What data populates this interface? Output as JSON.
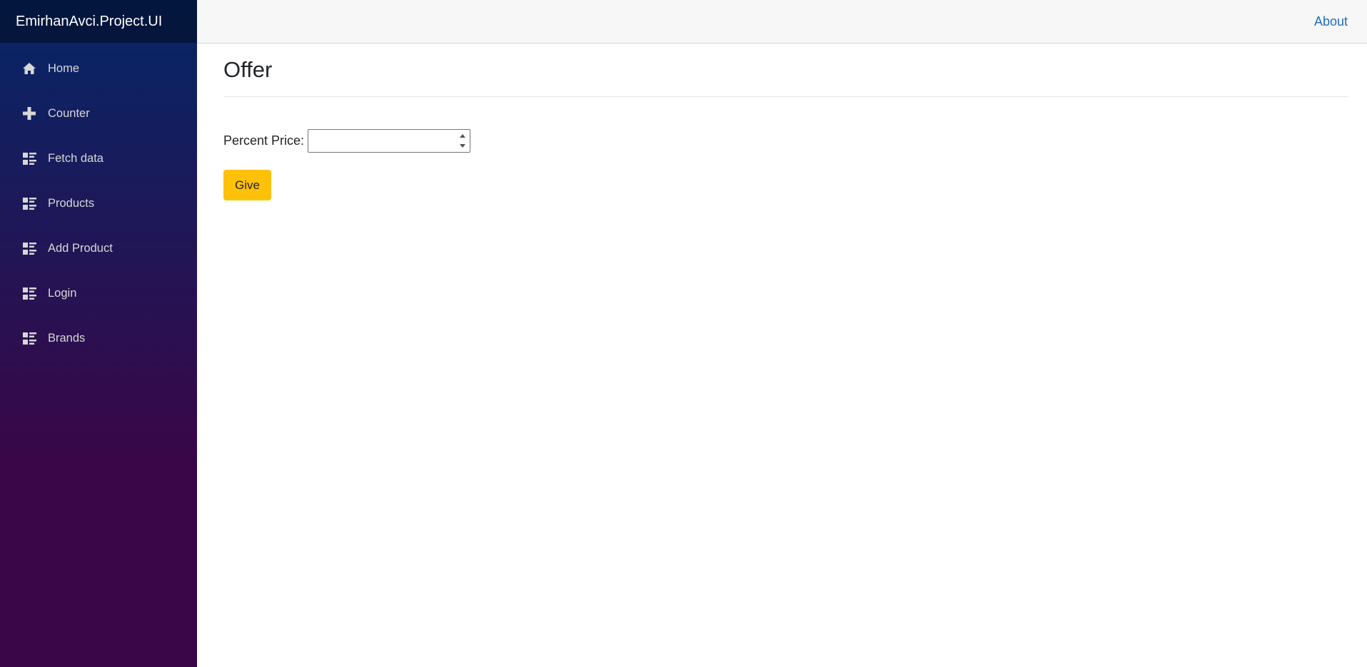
{
  "app": {
    "brand": "EmirhanAvci.Project.UI"
  },
  "sidebar": {
    "items": [
      {
        "label": "Home",
        "icon": "home-icon"
      },
      {
        "label": "Counter",
        "icon": "plus-icon"
      },
      {
        "label": "Fetch data",
        "icon": "list-icon"
      },
      {
        "label": "Products",
        "icon": "list-icon"
      },
      {
        "label": "Add Product",
        "icon": "list-icon"
      },
      {
        "label": "Login",
        "icon": "list-icon"
      },
      {
        "label": "Brands",
        "icon": "list-icon"
      }
    ]
  },
  "header": {
    "about_label": "About"
  },
  "main": {
    "title": "Offer",
    "form": {
      "percent_label": "Percent Price:",
      "percent_value": "",
      "give_label": "Give"
    }
  },
  "colors": {
    "sidebar_top": "#052767",
    "sidebar_bottom": "#3a0647",
    "link": "#1b6ec2",
    "button_warning": "#ffc107"
  }
}
